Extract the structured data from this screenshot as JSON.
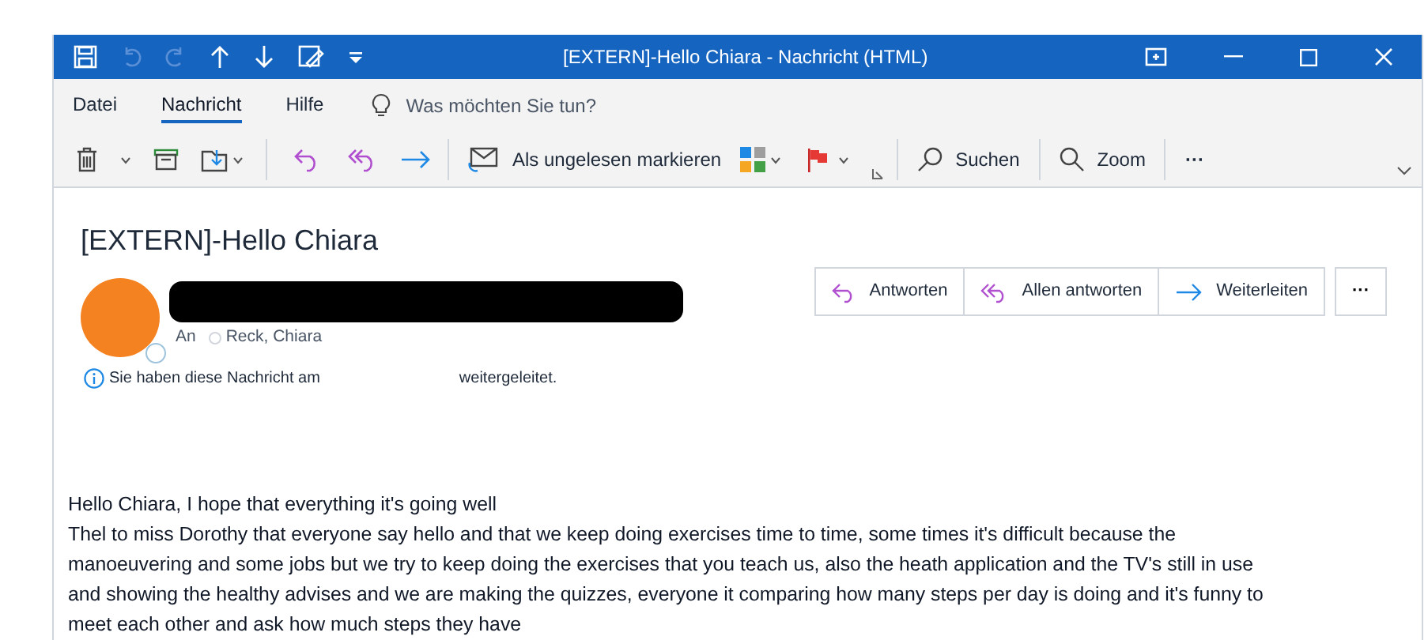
{
  "window": {
    "title": "[EXTERN]-Hello Chiara  -  Nachricht (HTML)"
  },
  "tabs": [
    {
      "label": "Datei",
      "selected": false
    },
    {
      "label": "Nachricht",
      "selected": true
    },
    {
      "label": "Hilfe",
      "selected": false
    }
  ],
  "search": {
    "placeholder": "Was möchten Sie tun?"
  },
  "toolbar": {
    "mark_unread": "Als ungelesen markieren",
    "search": "Suchen",
    "zoom": "Zoom",
    "more": "···"
  },
  "message": {
    "subject": "[EXTERN]-Hello Chiara",
    "to_label": "An",
    "recipient": "Reck, Chiara",
    "info_start": "Sie haben diese Nachricht am",
    "info_end": "weitergeleitet.",
    "actions": [
      "Antworten",
      "Allen antworten",
      "Weiterleiten"
    ],
    "more": "···"
  },
  "body": [
    "Hello Chiara, I hope that everything it's going well",
    "Thel to miss Dorothy that everyone say hello and that we keep doing exercises time to time, some times it's difficult because the",
    "manoeuvering and some jobs but we try to keep doing the exercises that you teach us, also the heath application and the TV's still in use",
    "and showing the healthy advises and we are making the quizzes, everyone it comparing how many steps per day is doing and it's funny to",
    "meet each other and ask how much steps they have"
  ]
}
